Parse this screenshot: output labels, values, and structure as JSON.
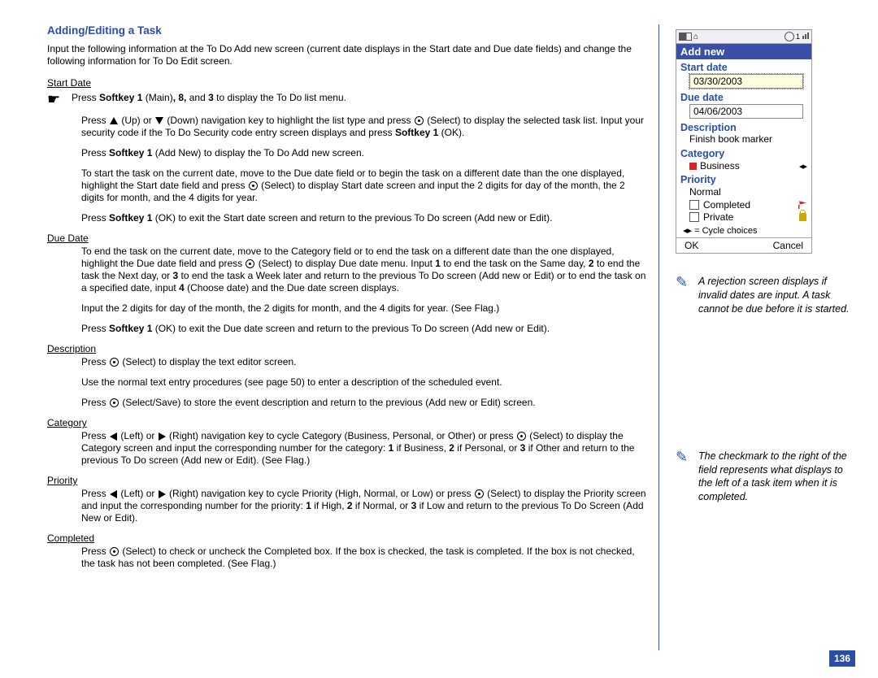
{
  "section_title": "Adding/Editing a Task",
  "intro": "Input the following information at the To Do Add new screen (current date displays in the Start date and Due date fields) and change the following information for To Do Edit screen.",
  "start_date": {
    "heading": "Start Date",
    "pointer_before": "Press ",
    "pointer_bold": "Softkey 1",
    "pointer_after1": " (Main)",
    "pointer_bold2": ", 8,",
    "pointer_after2": " and ",
    "pointer_bold3": "3",
    "pointer_after3": " to display the To Do list menu.",
    "p1a": "Press ",
    "p1b": " (Up) or ",
    "p1c": " (Down) navigation key to highlight the list type and press ",
    "p1d": " (Select) to display the selected task list. Input your security code if the To Do Security code entry screen displays and press ",
    "p1_bold": "Softkey 1",
    "p1e": " (OK).",
    "p2a": "Press ",
    "p2_bold": "Softkey 1",
    "p2b": " (Add New) to display the To Do Add new screen.",
    "p3a": "To start the task on the current date, move to the Due date field or to begin the task on a different date than the one displayed, highlight the Start date field and press ",
    "p3b": " (Select) to display Start date screen and input the 2 digits for day of the month, the 2 digits for month, and the 4 digits for year.",
    "p4a": "Press ",
    "p4_bold": "Softkey 1",
    "p4b": " (OK) to exit the Start date screen and return to the previous To Do screen (Add new or Edit)."
  },
  "due_date": {
    "heading": "Due Date",
    "p1a": "To end the task on the current date, move to the Category field or to end the task on a different date than the one displayed, highlight the Due date field and press ",
    "p1b": " (Select) to display Due date menu. Input ",
    "p1_b1": "1",
    "p1c": " to end the task on the Same day, ",
    "p1_b2": "2",
    "p1d": " to end the task the Next day, or ",
    "p1_b3": "3",
    "p1e": " to end the task a Week later and return to the previous To Do screen (Add new or Edit) or to end the task on a specified date, input ",
    "p1_b4": "4",
    "p1f": " (Choose date) and the Due date screen displays.",
    "p2": "Input the 2 digits for day of the month, the 2 digits for month, and the 4 digits for year. (See Flag.)",
    "p3a": "Press ",
    "p3_bold": "Softkey 1",
    "p3b": " (OK) to exit the Due date screen and return to the previous To Do screen (Add new or Edit)."
  },
  "description": {
    "heading": "Description",
    "p1a": "Press ",
    "p1b": " (Select) to display the text editor screen.",
    "p2": "Use the normal text entry procedures (see page 50) to enter a description of the scheduled event.",
    "p3a": "Press ",
    "p3b": " (Select/Save) to store the event description and return to the previous (Add new or Edit) screen."
  },
  "category": {
    "heading": "Category",
    "p1a": "Press ",
    "p1b": " (Left) or ",
    "p1c": " (Right) navigation key to cycle Category (Business, Personal, or Other) or press ",
    "p1d": " (Select) to display the Category screen and input the corresponding number for the category: ",
    "p1_b1": "1",
    "p1e": " if Business, ",
    "p1_b2": "2",
    "p1f": " if Personal, or ",
    "p1_b3": "3",
    "p1g": " if Other and return to the previous To Do screen (Add new or Edit). (See Flag.)"
  },
  "priority": {
    "heading": "Priority",
    "p1a": "Press ",
    "p1b": " (Left) or ",
    "p1c": " (Right) navigation key to cycle Priority (High, Normal, or Low) or press ",
    "p1d": " (Select) to display the Priority screen and input the corresponding number for the priority: ",
    "p1_b1": "1",
    "p1e": " if High, ",
    "p1_b2": "2",
    "p1f": " if Normal, or ",
    "p1_b3": "3",
    "p1g": " if Low and return to the previous To Do Screen (Add New or Edit)."
  },
  "completed": {
    "heading": "Completed",
    "p1a": "Press ",
    "p1b": " (Select) to check or uncheck the Completed box. If the box is checked, the task is completed. If the box is not checked, the task has not been completed. (See Flag.)"
  },
  "phone": {
    "title": "Add new",
    "start_label": "Start date",
    "start_val": "03/30/2003",
    "due_label": "Due date",
    "due_val": "04/06/2003",
    "desc_label": "Description",
    "desc_val": "Finish book marker",
    "cat_label": "Category",
    "cat_val": "Business",
    "pri_label": "Priority",
    "pri_val": "Normal",
    "completed": "Completed",
    "private": "Private",
    "cycle": "◂▸ = Cycle choices",
    "soft_left": "OK",
    "soft_right": "Cancel",
    "clock_badge": "1"
  },
  "note1": "A rejection screen displays if invalid dates are input. A task cannot be due before it is started.",
  "note2": "The checkmark to the right of the field represents what displays to the left of a task item when it is completed.",
  "page_number": "136"
}
